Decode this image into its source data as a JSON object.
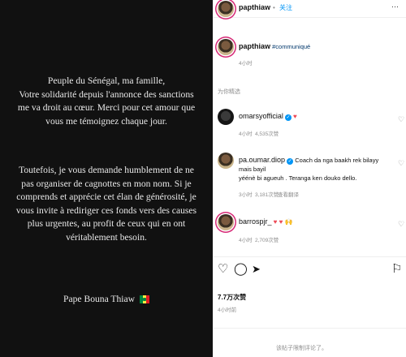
{
  "post": {
    "paragraph1": [
      "Peuple du Sénégal, ma famille,",
      "Votre solidarité depuis l'annonce des sanctions",
      "me va droit au cœur. Merci pour cet amour que",
      "vous me témoignez chaque jour."
    ],
    "paragraph2": [
      "Toutefois, je vous demande humblement de ne",
      "pas organiser de cagnottes en mon nom. Si je",
      "comprends et apprécie cet élan de générosité, je",
      "vous invite à rediriger ces fonds vers des causes",
      "plus urgentes, au profit de ceux qui en ont",
      "véritablement besoin."
    ],
    "signature": "Pape Bouna Thiaw"
  },
  "instagram": {
    "header": {
      "username": "papthiaw",
      "separator": "•",
      "follow_label": "关注",
      "more_label": "···"
    },
    "caption": {
      "username": "papthiaw",
      "hashtag": "#communiqué",
      "time": "4小时"
    },
    "sort_label": "为你精选",
    "comments": [
      {
        "username": "omarsyofficial",
        "text": "♥",
        "time": "4小时",
        "likes": "4,535次赞",
        "extra": ""
      },
      {
        "username": "pa.oumar.diop",
        "text_line1": "Coach da nga baakh rek bilayy mais bayil",
        "text_line2": "yéénè bi agueuh . Teranga ken douko dello.",
        "time": "3小时",
        "likes": "3,181次赞",
        "extra": "查看翻译"
      },
      {
        "username": "barrospjr_",
        "text": "♥ ♥ 🙌",
        "time": "4小时",
        "likes": "2,709次赞",
        "extra": ""
      }
    ],
    "likes_count": "7.7万次赞",
    "post_time": "4小时前",
    "comments_closed": "该帖子限制评论了。"
  },
  "colors": {
    "accent": "#0095f6",
    "heart": "#ed4956",
    "post_bg": "#111111"
  }
}
